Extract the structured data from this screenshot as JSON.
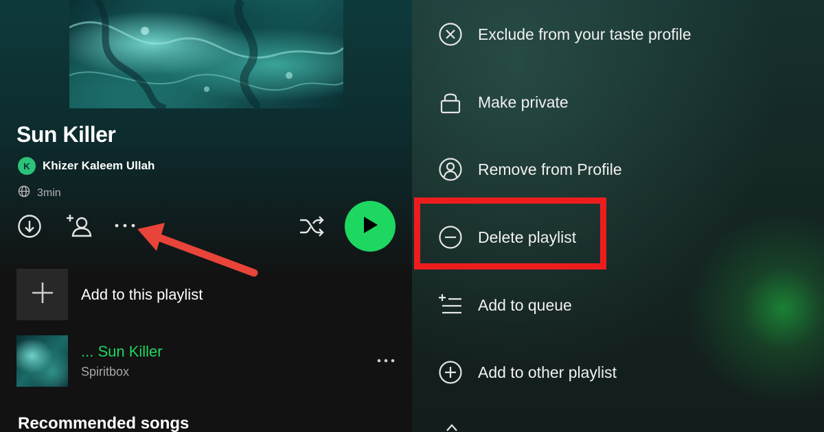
{
  "playlist": {
    "title": "Sun Killer",
    "owner_initial": "K",
    "owner_name": "Khizer Kaleem Ullah",
    "duration": "3min"
  },
  "controls": {
    "download_icon": "download-circle-icon",
    "add_user_icon": "add-user-icon",
    "more_icon": "more-dots-icon",
    "shuffle_icon": "shuffle-icon",
    "play_icon": "play-icon",
    "play_color": "#1ed760"
  },
  "add_to_playlist": {
    "label": "Add to this playlist",
    "icon": "plus-icon"
  },
  "tracks": [
    {
      "title": "... Sun Killer",
      "artist": "Spiritbox",
      "title_color": "#1ed760"
    }
  ],
  "sections": {
    "recommended": "Recommended songs"
  },
  "menu": {
    "items": [
      {
        "label": "Exclude from your taste profile",
        "icon": "close-circle-icon"
      },
      {
        "label": "Make private",
        "icon": "lock-icon"
      },
      {
        "label": "Remove from Profile",
        "icon": "profile-icon"
      },
      {
        "label": "Delete playlist",
        "icon": "minus-circle-icon"
      },
      {
        "label": "Add to queue",
        "icon": "add-to-queue-icon"
      },
      {
        "label": "Add to other playlist",
        "icon": "plus-circle-icon"
      }
    ]
  },
  "annotation": {
    "highlight_color": "#ee1d1d",
    "arrow_color": "#e8443a"
  }
}
